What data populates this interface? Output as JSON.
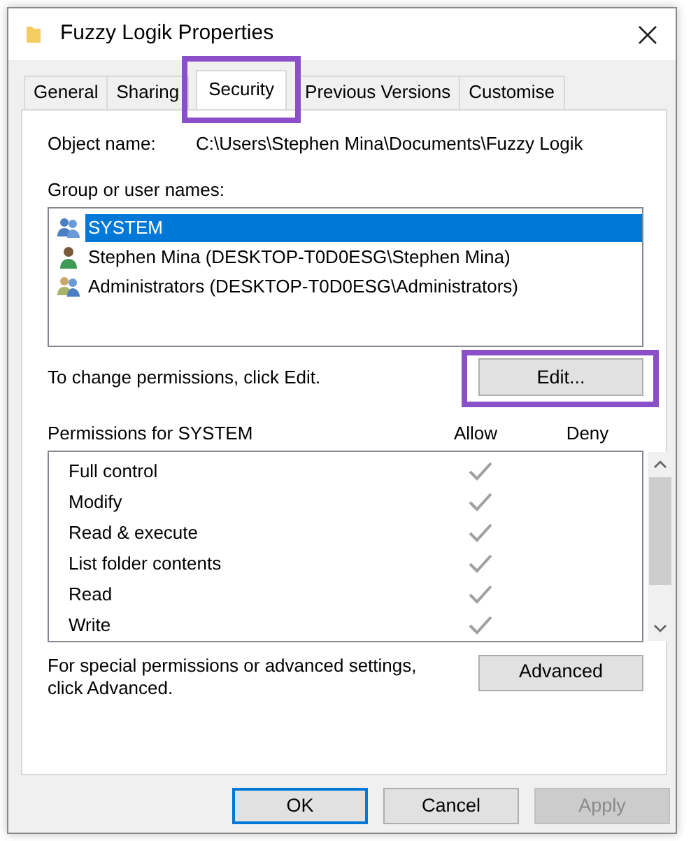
{
  "window": {
    "title": "Fuzzy Logik Properties"
  },
  "tabs": [
    {
      "label": "General",
      "selected": false,
      "highlighted": false
    },
    {
      "label": "Sharing",
      "selected": false,
      "highlighted": false
    },
    {
      "label": "Security",
      "selected": true,
      "highlighted": true
    },
    {
      "label": "Previous Versions",
      "selected": false,
      "highlighted": false
    },
    {
      "label": "Customise",
      "selected": false,
      "highlighted": false
    }
  ],
  "object_name": {
    "label": "Object name:",
    "value": "C:\\Users\\Stephen Mina\\Documents\\Fuzzy Logik"
  },
  "groups": {
    "label": "Group or user names:",
    "items": [
      {
        "name": "SYSTEM",
        "kind": "group",
        "selected": true
      },
      {
        "name": "Stephen Mina (DESKTOP-T0D0ESG\\Stephen Mina)",
        "kind": "user",
        "selected": false
      },
      {
        "name": "Administrators (DESKTOP-T0D0ESG\\Administrators)",
        "kind": "admins",
        "selected": false
      }
    ]
  },
  "change_hint": "To change permissions, click Edit.",
  "edit_button": {
    "label": "Edit...",
    "highlighted": true
  },
  "permissions": {
    "label": "Permissions for SYSTEM",
    "columns": [
      "Allow",
      "Deny"
    ],
    "rows": [
      {
        "name": "Full control",
        "allow": true,
        "deny": false
      },
      {
        "name": "Modify",
        "allow": true,
        "deny": false
      },
      {
        "name": "Read & execute",
        "allow": true,
        "deny": false
      },
      {
        "name": "List folder contents",
        "allow": true,
        "deny": false
      },
      {
        "name": "Read",
        "allow": true,
        "deny": false
      },
      {
        "name": "Write",
        "allow": true,
        "deny": false
      }
    ]
  },
  "advanced": {
    "text": "For special permissions or advanced settings, click Advanced.",
    "button": "Advanced"
  },
  "buttons": [
    {
      "label": "OK",
      "default": true,
      "disabled": false
    },
    {
      "label": "Cancel",
      "default": false,
      "disabled": false
    },
    {
      "label": "Apply",
      "default": false,
      "disabled": true
    }
  ]
}
